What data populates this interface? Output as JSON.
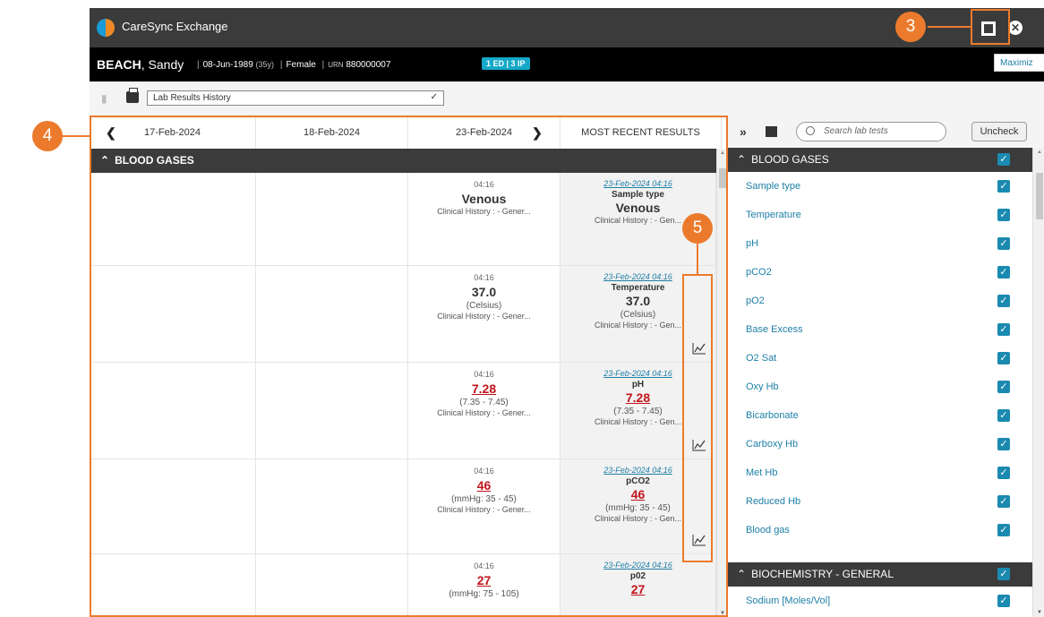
{
  "app": {
    "title": "CareSync Exchange",
    "maximize_tooltip": "Maximiz",
    "close_glyph": "✕"
  },
  "patient": {
    "surname": "BEACH",
    "given": ", Sandy",
    "dob": "08-Jun-1989",
    "age": "(35y)",
    "sex": "Female",
    "urn_label": "URN",
    "urn": "880000007",
    "badge": "1 ED | 3 IP",
    "sep": "|"
  },
  "toolbar": {
    "view_select": "Lab Results History"
  },
  "results": {
    "columns": [
      {
        "label": "17-Feb-2024"
      },
      {
        "label": "18-Feb-2024"
      },
      {
        "label": "23-Feb-2024"
      },
      {
        "label": "MOST RECENT RESULTS"
      }
    ],
    "section": "BLOOD GASES",
    "rows": [
      {
        "time": "04:16",
        "value": "Venous",
        "range": "",
        "history": "Clinical History : - Gener...",
        "recent_date": "23-Feb-2024 04:16",
        "recent_name": "Sample type",
        "recent_value": "Venous",
        "recent_range": "",
        "recent_history": "Clinical History : - Gen..."
      },
      {
        "time": "04:16",
        "value": "37.0",
        "range": "(Celsius)",
        "history": "Clinical History : - Gener...",
        "recent_date": "23-Feb-2024 04:16",
        "recent_name": "Temperature",
        "recent_value": "37.0",
        "recent_range": "(Celsius)",
        "recent_history": "Clinical History : - Gen..."
      },
      {
        "time": "04:16",
        "value": "7.28",
        "range": "(7.35 - 7.45)",
        "history": "Clinical History : - Gener...",
        "recent_date": "23-Feb-2024 04:16",
        "recent_name": "pH",
        "recent_value": "7.28",
        "recent_range": "(7.35 - 7.45)",
        "recent_history": "Clinical History : - Gen..."
      },
      {
        "time": "04:16",
        "value": "46",
        "range": "(mmHg: 35 - 45)",
        "history": "Clinical History : - Gener...",
        "recent_date": "23-Feb-2024 04:16",
        "recent_name": "pCO2",
        "recent_value": "46",
        "recent_range": "(mmHg: 35 - 45)",
        "recent_history": "Clinical History : - Gen..."
      },
      {
        "time": "04:16",
        "value": "27",
        "range": "(mmHg: 75 - 105)",
        "history": "",
        "recent_date": "23-Feb-2024 04:16",
        "recent_name": "p02",
        "recent_value": "27",
        "recent_range": "",
        "recent_history": ""
      }
    ]
  },
  "filter": {
    "search_placeholder": "Search lab tests",
    "uncheck_label": "Uncheck",
    "collapse_glyph": "»",
    "section1": "BLOOD GASES",
    "items": [
      "Sample type",
      "Temperature",
      "pH",
      "pCO2",
      "pO2",
      "Base Excess",
      "O2 Sat",
      "Oxy Hb",
      "Bicarbonate",
      "Carboxy Hb",
      "Met Hb",
      "Reduced Hb",
      "Blood gas"
    ],
    "section2": "BIOCHEMISTRY - GENERAL",
    "items2": [
      "Sodium [Moles/Vol]"
    ]
  },
  "callouts": {
    "c3": "3",
    "c4": "4",
    "c5": "5"
  },
  "colors": {
    "accent": "#ec7a2c",
    "abnormal": "#c2141c",
    "link": "#1d7fa6",
    "check": "#1b8ab0",
    "header_bg": "#3b3b3b"
  }
}
